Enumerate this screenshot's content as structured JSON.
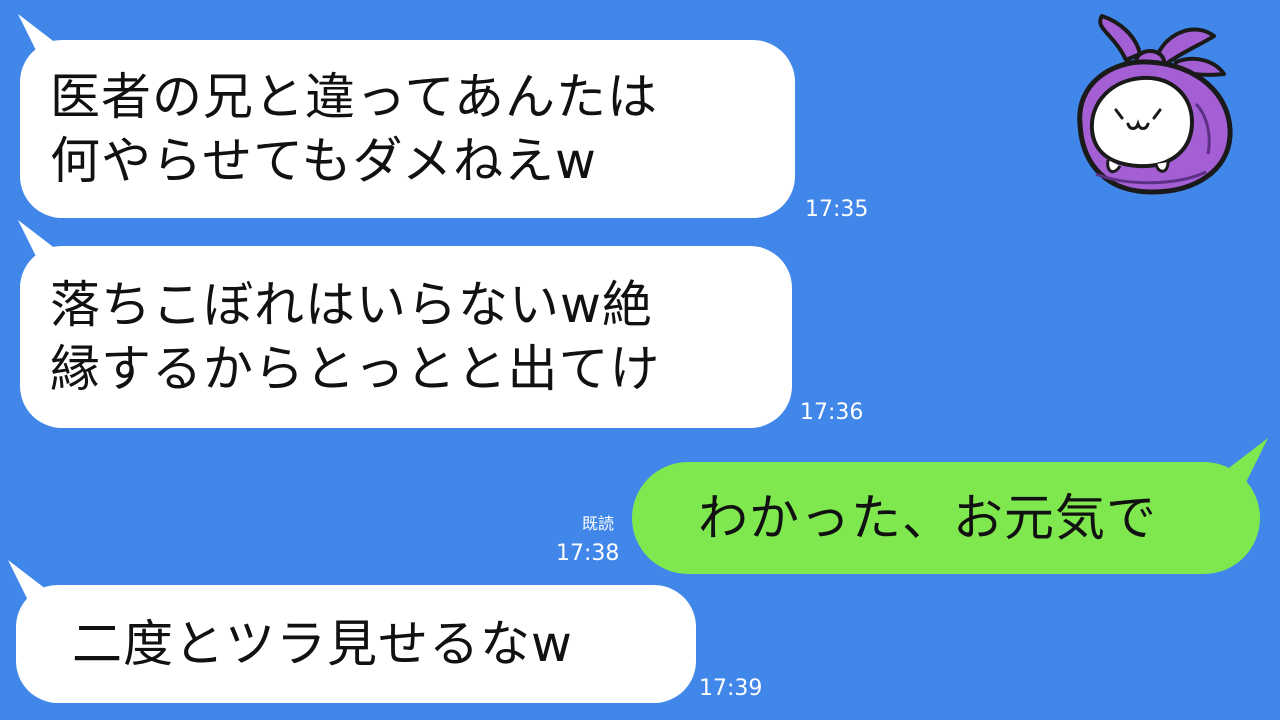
{
  "messages": [
    {
      "side": "incoming",
      "lines": [
        "医者の兄と違ってあんたは",
        "何やらせてもダメねえw"
      ],
      "time": "17:35"
    },
    {
      "side": "incoming",
      "lines": [
        "落ちこぼれはいらないw絶",
        "縁するからとっとと出てけ"
      ],
      "time": "17:36"
    },
    {
      "side": "outgoing",
      "lines": [
        "わかった、お元気で"
      ],
      "read_label": "既読",
      "time": "17:38"
    },
    {
      "side": "incoming",
      "lines": [
        "二度とツラ見せるなw"
      ],
      "time": "17:39"
    }
  ],
  "avatar": {
    "icon": "purple-furoshiki-character-icon",
    "face_text": "(・ω・)"
  },
  "colors": {
    "background": "#4187e9",
    "incoming_bubble": "#ffffff",
    "outgoing_bubble": "#7fe84f",
    "avatar_cloth": "#a45fd4",
    "text": "#111111"
  }
}
